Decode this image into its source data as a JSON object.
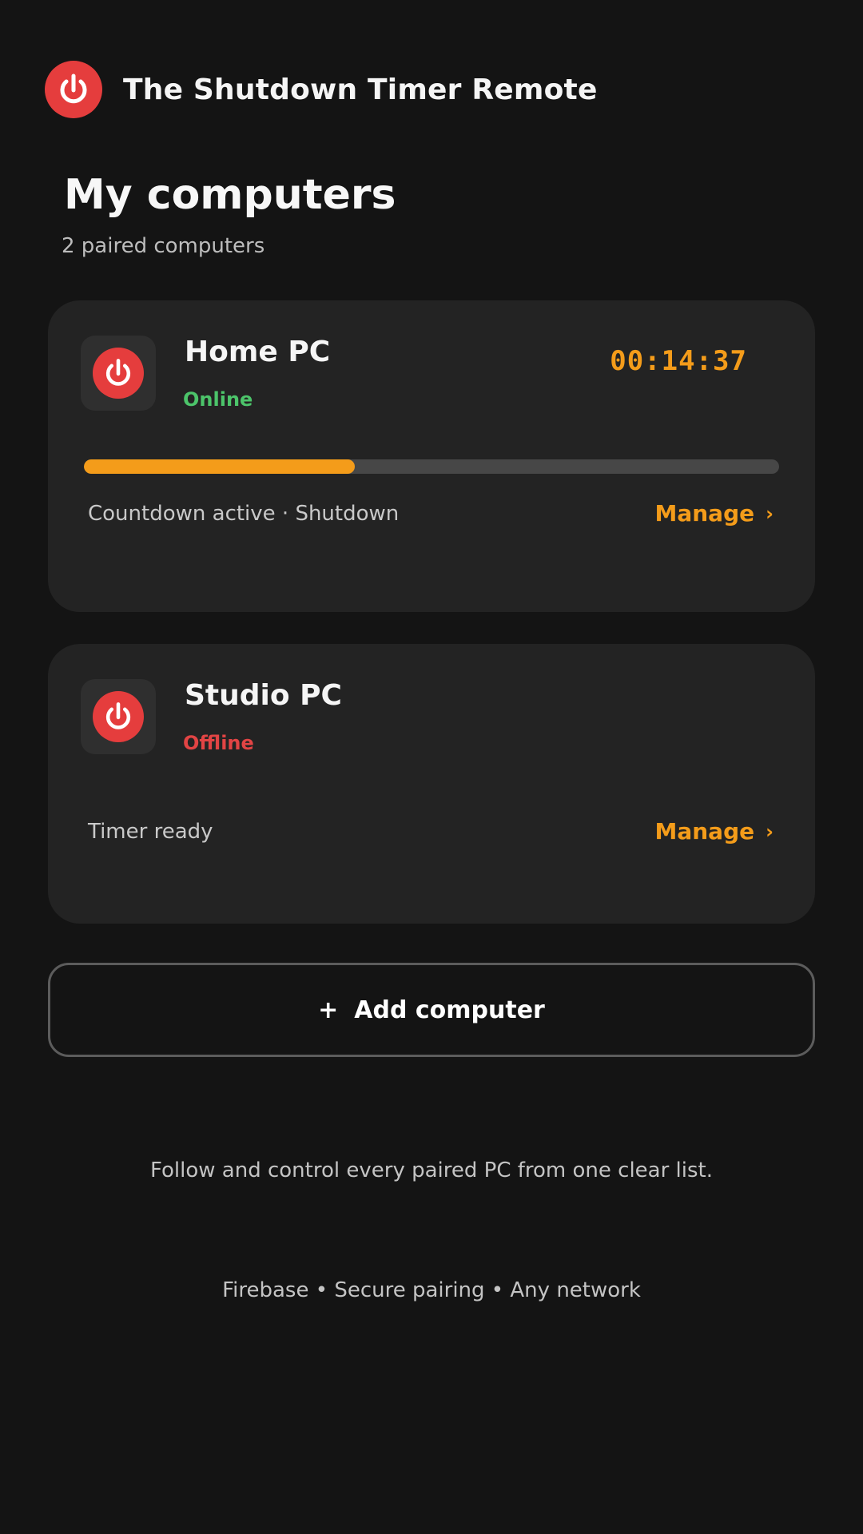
{
  "header": {
    "logo_icon": "power-icon",
    "title": "The Shutdown Timer Remote"
  },
  "page": {
    "title": "My computers",
    "subtitle": "2 paired computers"
  },
  "computers": [
    {
      "name": "Home PC",
      "icon": "power-icon",
      "status": "Online",
      "status_color": "#4cc46a",
      "countdown": "00:14:37",
      "progress_percent": 39,
      "note": "Countdown active · Shutdown",
      "manage_label": "Manage",
      "manage_chevron": "›"
    },
    {
      "name": "Studio PC",
      "icon": "power-icon",
      "status": "Offline",
      "status_color": "#e24444",
      "note": "Timer ready",
      "manage_label": "Manage",
      "manage_chevron": "›"
    }
  ],
  "add_button": {
    "icon": "+",
    "label": "Add computer"
  },
  "footer": {
    "description": "Follow and control every paired PC from one clear list.",
    "tags": "Firebase • Secure pairing • Any network"
  },
  "colors": {
    "background": "#141414",
    "card": "#232323",
    "accent": "#f49c1a",
    "brand_red": "#e53d3d"
  }
}
